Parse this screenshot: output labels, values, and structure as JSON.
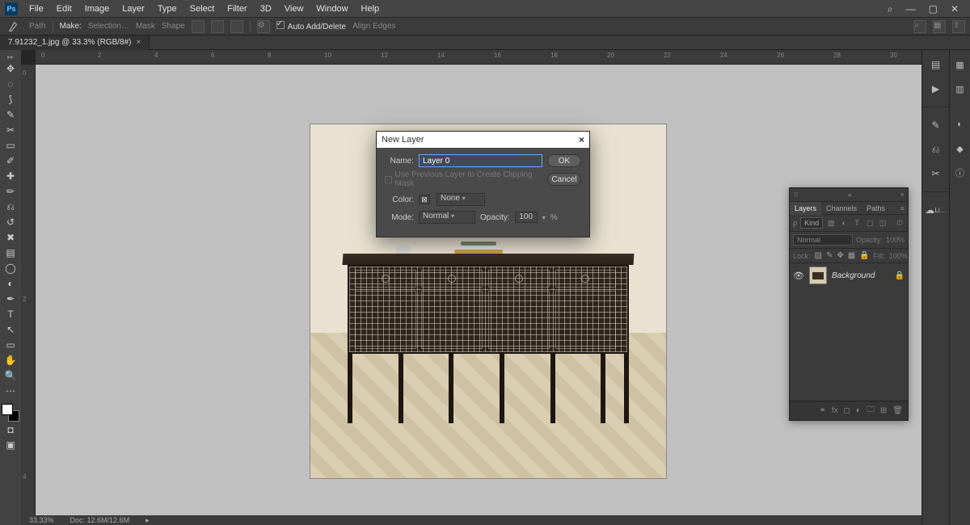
{
  "menus": [
    "File",
    "Edit",
    "Image",
    "Layer",
    "Type",
    "Select",
    "Filter",
    "3D",
    "View",
    "Window",
    "Help"
  ],
  "options": {
    "path": "Path",
    "make": "Make:",
    "selection": "Selection…",
    "mask": "Mask",
    "shape": "Shape",
    "autoadd": "Auto Add/Delete",
    "align": "Align Edges"
  },
  "doc": {
    "tab": "7.91232_1.jpg @ 33.3% (RGB/8#)",
    "zoom": "33.33%",
    "docsize": "Doc: 12.6M/12.6M"
  },
  "rulerH": [
    "0",
    "2",
    "4",
    "6",
    "8",
    "10",
    "12",
    "14",
    "16",
    "18",
    "20",
    "22",
    "24",
    "26",
    "28",
    "30"
  ],
  "rulerV": [
    "0",
    "2",
    "4"
  ],
  "dialog": {
    "title": "New Layer",
    "name_label": "Name:",
    "name_value": "Layer 0",
    "prev": "Use Previous Layer to Create Clipping Mask",
    "color_label": "Color:",
    "color_value": "None",
    "mode_label": "Mode:",
    "mode_value": "Normal",
    "opacity_label": "Opacity:",
    "opacity_value": "100",
    "pct": "%",
    "ok": "OK",
    "cancel": "Cancel"
  },
  "layers": {
    "tabs": [
      "Layers",
      "Channels",
      "Paths"
    ],
    "kind": "Kind",
    "blend": "Normal",
    "opacity_lbl": "Opacity:",
    "opacity": "100%",
    "lock_lbl": "Lock:",
    "fill_lbl": "Fill:",
    "fill": "100%",
    "item": "Background",
    "libraries": "Li…"
  }
}
